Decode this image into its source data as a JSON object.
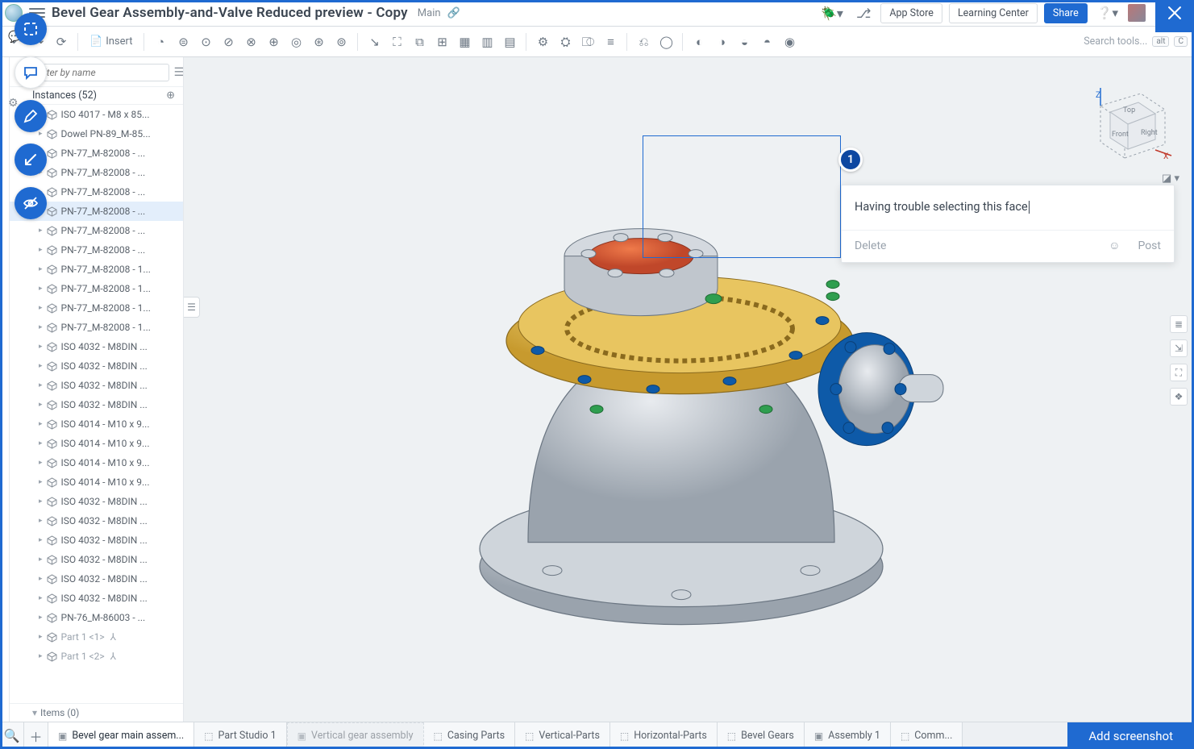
{
  "header": {
    "title": "Bevel Gear Assembly-and-Valve Reduced preview - Copy",
    "branch": "Main",
    "buttons": {
      "appstore": "App Store",
      "learning": "Learning Center",
      "share": "Share"
    }
  },
  "toolbar": {
    "insert": "Insert",
    "search_placeholder": "Search tools...",
    "kbd1": "alt",
    "kbd2": "C"
  },
  "filter": {
    "placeholder": "Filter by name"
  },
  "instances_header": "Instances (52)",
  "items_footer": "Items (0)",
  "tree": [
    {
      "label": "ISO 4017 - M8 x 85...",
      "dim": false
    },
    {
      "label": "Dowel PN-89_M-85...",
      "dim": false
    },
    {
      "label": "PN-77_M-82008 - ...",
      "dim": false
    },
    {
      "label": "PN-77_M-82008 - ...",
      "dim": false
    },
    {
      "label": "PN-77_M-82008 - ...",
      "dim": false
    },
    {
      "label": "PN-77_M-82008 - ...",
      "dim": false,
      "selected": true
    },
    {
      "label": "PN-77_M-82008 - ...",
      "dim": false
    },
    {
      "label": "PN-77_M-82008 - ...",
      "dim": false
    },
    {
      "label": "PN-77_M-82008 - 1...",
      "dim": false
    },
    {
      "label": "PN-77_M-82008 - 1...",
      "dim": false
    },
    {
      "label": "PN-77_M-82008 - 1...",
      "dim": false
    },
    {
      "label": "PN-77_M-82008 - 1...",
      "dim": false
    },
    {
      "label": "ISO 4032 - M8DIN ...",
      "dim": false
    },
    {
      "label": "ISO 4032 - M8DIN ...",
      "dim": false
    },
    {
      "label": "ISO 4032 - M8DIN ...",
      "dim": false
    },
    {
      "label": "ISO 4032 - M8DIN ...",
      "dim": false
    },
    {
      "label": "ISO 4014 - M10 x 9...",
      "dim": false
    },
    {
      "label": "ISO 4014 - M10 x 9...",
      "dim": false
    },
    {
      "label": "ISO 4014 - M10 x 9...",
      "dim": false
    },
    {
      "label": "ISO 4014 - M10 x 9...",
      "dim": false
    },
    {
      "label": "ISO 4032 - M8DIN ...",
      "dim": false
    },
    {
      "label": "ISO 4032 - M8DIN ...",
      "dim": false
    },
    {
      "label": "ISO 4032 - M8DIN ...",
      "dim": false
    },
    {
      "label": "ISO 4032 - M8DIN ...",
      "dim": false
    },
    {
      "label": "ISO 4032 - M8DIN ...",
      "dim": false
    },
    {
      "label": "ISO 4032 - M8DIN ...",
      "dim": false
    },
    {
      "label": "PN-76_M-86003 - ...",
      "dim": false
    },
    {
      "label": "Part 1 <1>",
      "dim": true,
      "mate": true
    },
    {
      "label": "Part 1 <2>",
      "dim": true,
      "mate": true
    }
  ],
  "comment": {
    "pin": "1",
    "text": "Having trouble selecting this face",
    "delete": "Delete",
    "post": "Post"
  },
  "viewcube": {
    "front": "Front",
    "top": "Top",
    "right": "Right",
    "z": "Z",
    "x": "X"
  },
  "tabs": {
    "list": [
      {
        "label": "Bevel gear main assem...",
        "type": "asm",
        "active": true
      },
      {
        "label": "Part Studio 1",
        "type": "part"
      },
      {
        "label": "Vertical gear assembly",
        "type": "asm",
        "ghost": true
      },
      {
        "label": "Casing Parts",
        "type": "part"
      },
      {
        "label": "Vertical-Parts",
        "type": "part"
      },
      {
        "label": "Horizontal-Parts",
        "type": "part"
      },
      {
        "label": "Bevel Gears",
        "type": "part"
      },
      {
        "label": "Assembly 1",
        "type": "asm"
      },
      {
        "label": "Comm...",
        "type": "part"
      }
    ],
    "add_screenshot": "Add screenshot"
  }
}
